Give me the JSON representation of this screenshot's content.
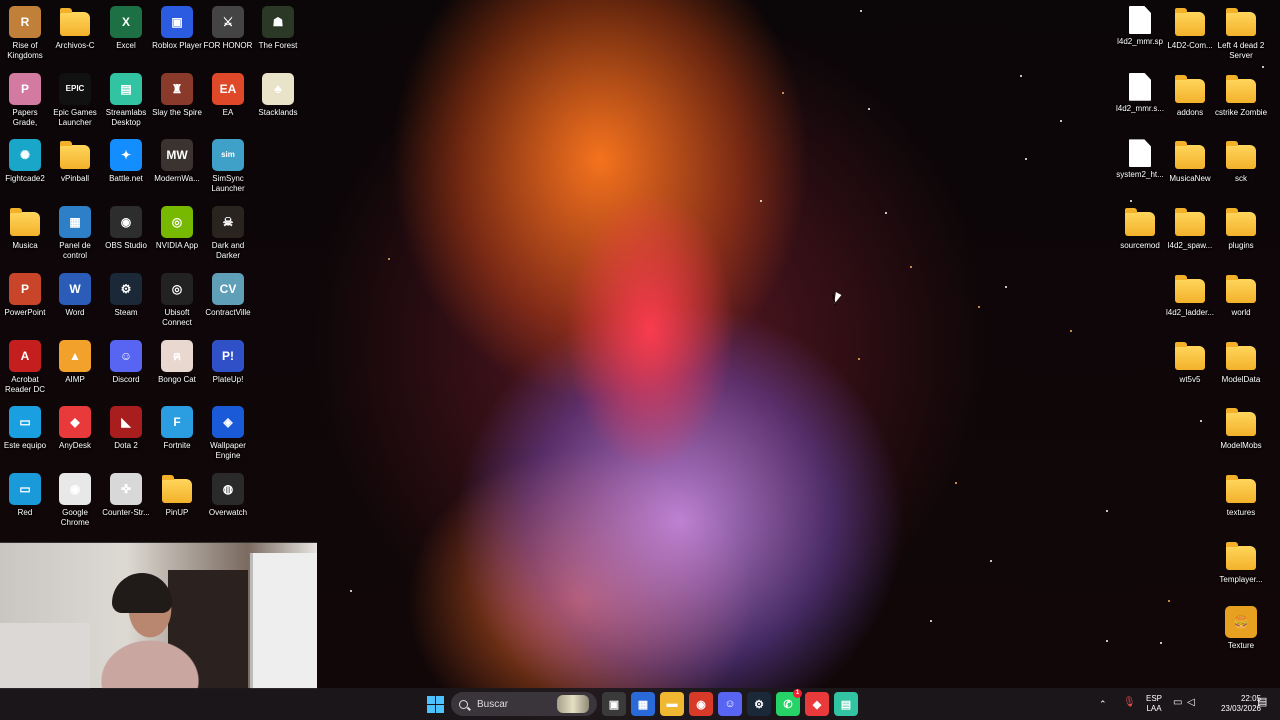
{
  "desktop": {
    "left_icons": [
      {
        "label": "Rise of Kingdoms",
        "icon": "game-icon",
        "color": "#c0803a",
        "glyph": "R"
      },
      {
        "label": "Archivos-C",
        "icon": "folder-icon",
        "type": "folder"
      },
      {
        "label": "Excel",
        "icon": "excel-icon",
        "color": "#1d7044",
        "glyph": "X"
      },
      {
        "label": "Roblox Player",
        "icon": "roblox-icon",
        "color": "#2a5be0",
        "glyph": "▣"
      },
      {
        "label": "FOR HONOR",
        "icon": "for-honor-icon",
        "color": "#444444",
        "glyph": "⚔"
      },
      {
        "label": "The Forest",
        "icon": "the-forest-icon",
        "color": "#2b3826",
        "glyph": "☗"
      },
      {
        "label": "Papers Grade, Please!",
        "icon": "papers-please-icon",
        "color": "#d27aa0",
        "glyph": "P"
      },
      {
        "label": "Epic Games Launcher",
        "icon": "epic-games-icon",
        "color": "#111111",
        "glyph": "EPIC"
      },
      {
        "label": "Streamlabs Desktop",
        "icon": "streamlabs-icon",
        "color": "#31c3a2",
        "glyph": "▤"
      },
      {
        "label": "Slay the Spire",
        "icon": "slay-the-spire-icon",
        "color": "#8a3a2a",
        "glyph": "♜"
      },
      {
        "label": "EA",
        "icon": "ea-icon",
        "color": "#e0482a",
        "glyph": "EA"
      },
      {
        "label": "Stacklands",
        "icon": "stacklands-icon",
        "color": "#e9e4c9",
        "glyph": "♣"
      },
      {
        "label": "Fightcade2",
        "icon": "fightcade-icon",
        "color": "#1aa6c9",
        "glyph": "✺"
      },
      {
        "label": "vPinball",
        "icon": "folder-icon",
        "type": "folder"
      },
      {
        "label": "Battle.net",
        "icon": "battlenet-icon",
        "color": "#148eff",
        "glyph": "✦"
      },
      {
        "label": "ModernWa...",
        "icon": "modern-warfare-icon",
        "color": "#3a3330",
        "glyph": "MW"
      },
      {
        "label": "SimSync Launcher",
        "icon": "simsync-icon",
        "color": "#3fa0c8",
        "glyph": "sim"
      },
      {
        "label": "Musica",
        "icon": "folder-icon",
        "type": "folder"
      },
      {
        "label": "Panel de control",
        "icon": "control-panel-icon",
        "color": "#2d80c8",
        "glyph": "▦"
      },
      {
        "label": "OBS Studio",
        "icon": "obs-icon",
        "color": "#2d2d2d",
        "glyph": "◉"
      },
      {
        "label": "NVIDIA App",
        "icon": "nvidia-icon",
        "color": "#76b900",
        "glyph": "◎"
      },
      {
        "label": "Dark and Darker",
        "icon": "dark-and-darker-icon",
        "color": "#2a2420",
        "glyph": "☠"
      },
      {
        "label": "PowerPoint",
        "icon": "powerpoint-icon",
        "color": "#c8452a",
        "glyph": "P"
      },
      {
        "label": "Word",
        "icon": "word-icon",
        "color": "#2b5cb8",
        "glyph": "W"
      },
      {
        "label": "Steam",
        "icon": "steam-icon",
        "color": "#1b2838",
        "glyph": "⚙"
      },
      {
        "label": "Ubisoft Connect",
        "icon": "ubisoft-icon",
        "color": "#222222",
        "glyph": "◎"
      },
      {
        "label": "ContractVille",
        "icon": "contractville-icon",
        "color": "#5fa0b8",
        "glyph": "CV"
      },
      {
        "label": "Acrobat Reader DC",
        "icon": "acrobat-icon",
        "color": "#c41e1e",
        "glyph": "A"
      },
      {
        "label": "AIMP",
        "icon": "aimp-icon",
        "color": "#f2a22a",
        "glyph": "▲"
      },
      {
        "label": "Discord",
        "icon": "discord-icon",
        "color": "#5865f2",
        "glyph": "☺"
      },
      {
        "label": "Bongo Cat",
        "icon": "bongo-cat-icon",
        "color": "#e8d8d0",
        "glyph": "ฅ"
      },
      {
        "label": "PlateUp!",
        "icon": "plateup-icon",
        "color": "#3050c8",
        "glyph": "P!"
      },
      {
        "label": "Este equipo",
        "icon": "this-pc-icon",
        "color": "#1aa0e0",
        "glyph": "▭"
      },
      {
        "label": "AnyDesk",
        "icon": "anydesk-icon",
        "color": "#e83a3a",
        "glyph": "◆"
      },
      {
        "label": "Dota 2",
        "icon": "dota2-icon",
        "color": "#a81e1e",
        "glyph": "◣"
      },
      {
        "label": "Fortnite",
        "icon": "fortnite-icon",
        "color": "#2a9ee0",
        "glyph": "F"
      },
      {
        "label": "Wallpaper Engine",
        "icon": "wallpaper-engine-icon",
        "color": "#1a5ad8",
        "glyph": "◈"
      },
      {
        "label": "Red",
        "icon": "network-icon",
        "color": "#1a9ad8",
        "glyph": "▭"
      },
      {
        "label": "Google Chrome",
        "icon": "chrome-icon",
        "color": "#e8e8e8",
        "glyph": "◉"
      },
      {
        "label": "Counter-Str...",
        "icon": "counter-strike-icon",
        "color": "#d8d8d8",
        "glyph": "✜"
      },
      {
        "label": "PinUP",
        "icon": "folder-icon",
        "type": "folder"
      },
      {
        "label": "Overwatch",
        "icon": "overwatch-icon",
        "color": "#2a2a2a",
        "glyph": "◍"
      }
    ],
    "right_icons": [
      {
        "label": "l4d2_mmr.sp",
        "icon": "file-icon",
        "type": "doc"
      },
      {
        "label": "L4D2-Com...",
        "icon": "folder-icon",
        "type": "folder"
      },
      {
        "label": "Left 4 dead 2 Server",
        "icon": "folder-icon",
        "type": "folder"
      },
      {
        "label": "l4d2_mmr.s...",
        "icon": "file-icon",
        "type": "doc"
      },
      {
        "label": "addons",
        "icon": "folder-icon",
        "type": "folder"
      },
      {
        "label": "cstrike Zombie",
        "icon": "folder-icon",
        "type": "folder"
      },
      {
        "label": "system2_ht...",
        "icon": "file-icon",
        "type": "doc"
      },
      {
        "label": "MusicaNew",
        "icon": "folder-icon",
        "type": "folder"
      },
      {
        "label": "sck",
        "icon": "folder-icon",
        "type": "folder"
      },
      {
        "label": "sourcemod",
        "icon": "folder-icon",
        "type": "folder"
      },
      {
        "label": "l4d2_spaw...",
        "icon": "folder-icon",
        "type": "folder"
      },
      {
        "label": "plugins",
        "icon": "folder-icon",
        "type": "folder"
      },
      {
        "label": "l4d2_ladder...",
        "icon": "folder-icon",
        "type": "folder"
      },
      {
        "label": "world",
        "icon": "folder-icon",
        "type": "folder"
      },
      {
        "label": "wt5v5",
        "icon": "folder-icon",
        "type": "folder"
      },
      {
        "label": "ModelData",
        "icon": "folder-icon",
        "type": "folder"
      },
      {
        "label": "ModelMobs",
        "icon": "folder-icon",
        "type": "folder"
      },
      {
        "label": "textures",
        "icon": "folder-icon",
        "type": "folder"
      },
      {
        "label": "Templayer...",
        "icon": "folder-icon",
        "type": "folder"
      },
      {
        "label": "Texture",
        "icon": "texture-icon",
        "color": "#e8a020",
        "glyph": "🍔"
      }
    ]
  },
  "taskbar": {
    "search_placeholder": "Buscar",
    "pinned": [
      {
        "name": "task-view-icon",
        "glyph": "▣",
        "color": "#3a3a3a"
      },
      {
        "name": "microsoft-store-icon",
        "glyph": "▦",
        "color": "#2a6ad8"
      },
      {
        "name": "file-explorer-icon",
        "glyph": "▬",
        "color": "#f0b830"
      },
      {
        "name": "chrome-icon",
        "glyph": "◉",
        "color": "#d83a2a"
      },
      {
        "name": "discord-icon",
        "glyph": "☺",
        "color": "#5865f2"
      },
      {
        "name": "steam-icon",
        "glyph": "⚙",
        "color": "#1b2838"
      },
      {
        "name": "whatsapp-icon",
        "glyph": "✆",
        "color": "#25d366",
        "badge": "1"
      },
      {
        "name": "anydesk-icon",
        "glyph": "◆",
        "color": "#e83a3a"
      },
      {
        "name": "streamlabs-icon",
        "glyph": "▤",
        "color": "#31c3a2"
      }
    ],
    "tray": {
      "language_top": "ESP",
      "language_bottom": "LAA",
      "time": "22:05",
      "date": "23/03/2026"
    }
  }
}
